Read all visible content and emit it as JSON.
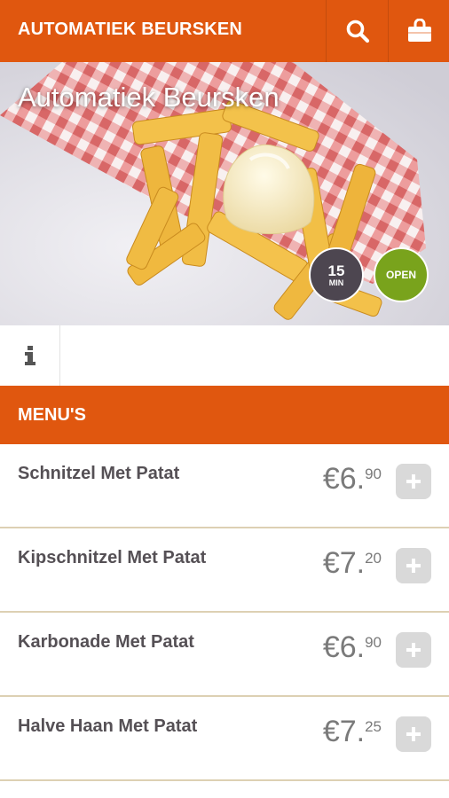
{
  "header": {
    "brand": "AUTOMATIEK BEURSKEN",
    "search_icon": "search-icon",
    "cart_icon": "shopping-bag-icon"
  },
  "hero": {
    "title": "Automatiek Beursken",
    "delivery_time_value": "15",
    "delivery_time_unit": "MIN",
    "status": "OPEN"
  },
  "tabs": {
    "info_icon": "info-icon"
  },
  "menu": {
    "title": "MENU'S",
    "items": [
      {
        "name": "Schnitzel Met Patat",
        "price_main": "€6.",
        "price_cents": "90"
      },
      {
        "name": "Kipschnitzel Met Patat",
        "price_main": "€7.",
        "price_cents": "20"
      },
      {
        "name": "Karbonade Met Patat",
        "price_main": "€6.",
        "price_cents": "90"
      },
      {
        "name": "Halve Haan Met Patat",
        "price_main": "€7.",
        "price_cents": "25"
      }
    ]
  },
  "colors": {
    "accent": "#e0570f",
    "open": "#79a31c",
    "time_badge": "#4d4650",
    "divider": "#ddd0b3"
  }
}
